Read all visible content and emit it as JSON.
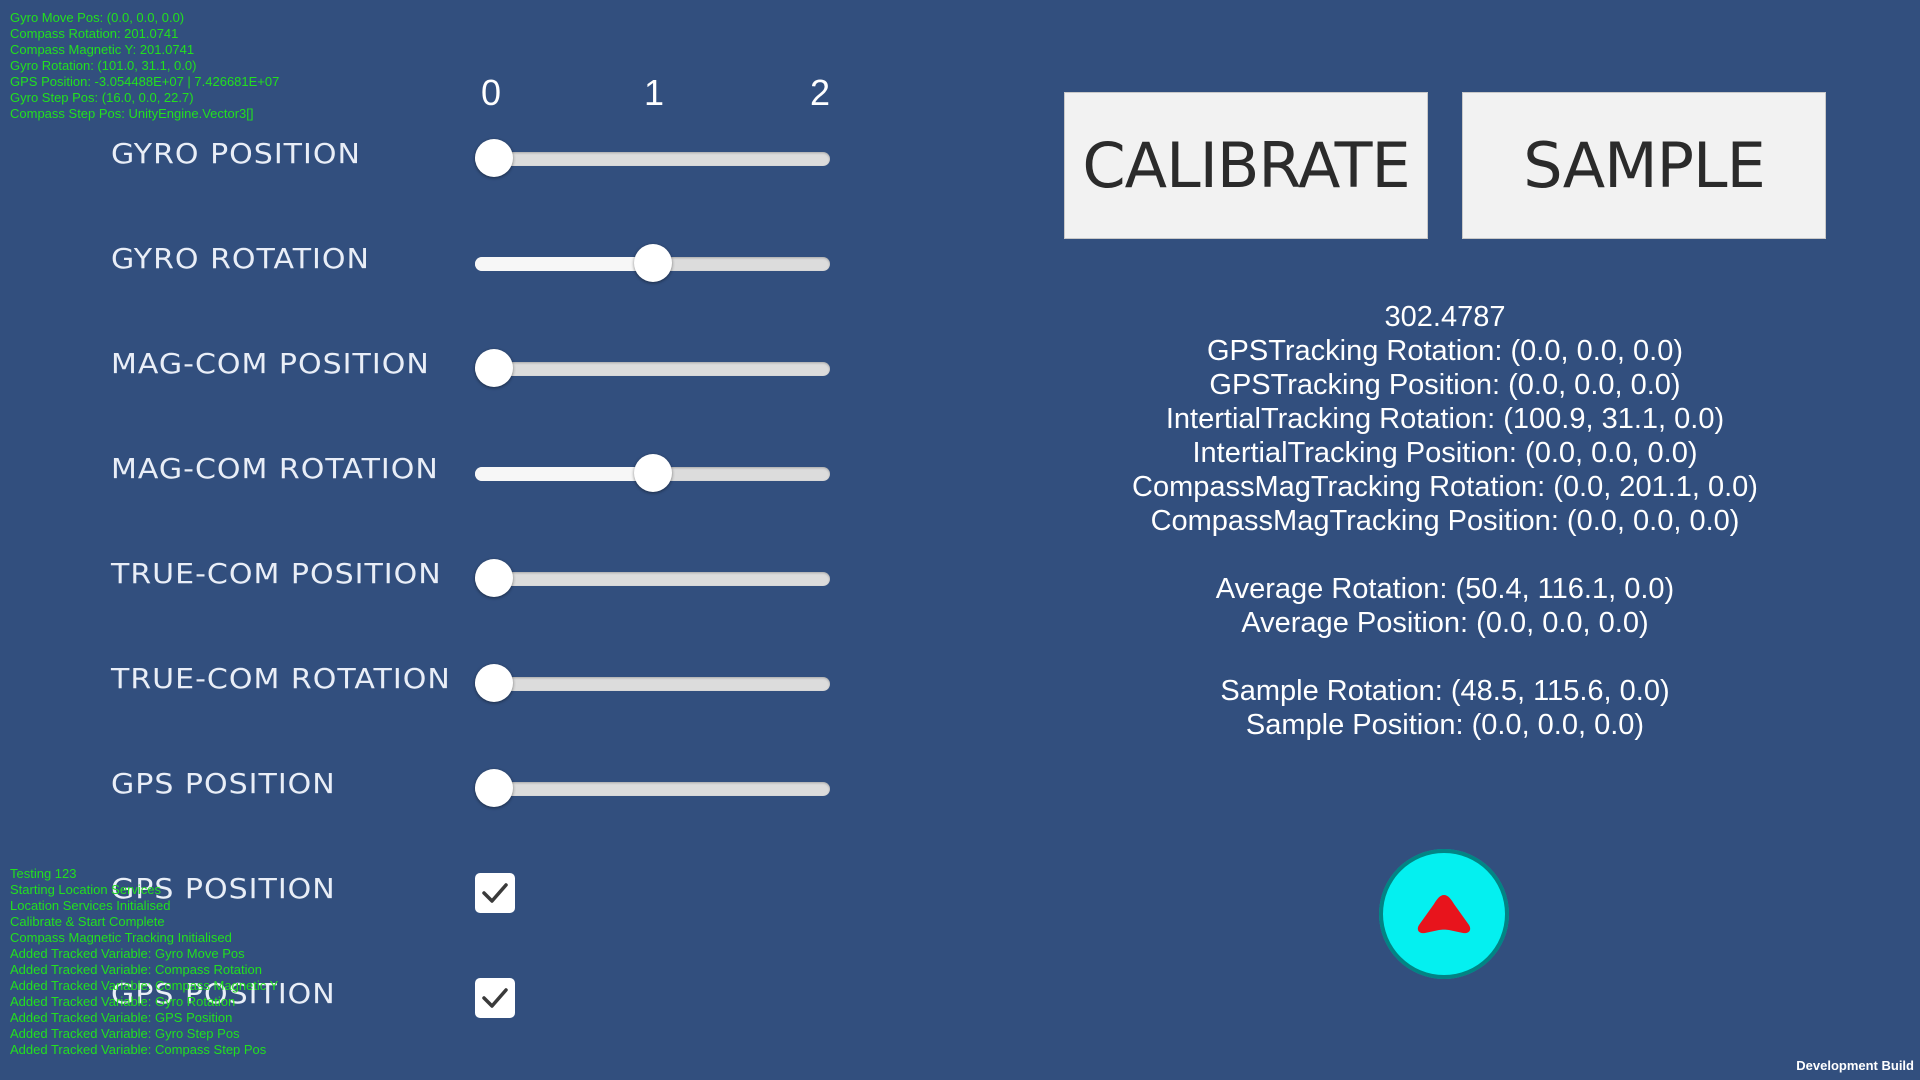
{
  "debug_top": [
    "Gyro Move Pos: (0.0, 0.0, 0.0)",
    "Compass Rotation: 201.0741",
    "Compass Magnetic Y: 201.0741",
    "Gyro Rotation: (101.0, 31.1, 0.0)",
    "GPS Position: -3.054488E+07 | 7.426681E+07",
    "Gyro Step Pos: (16.0, 0.0, 22.7)",
    "Compass Step Pos: UnityEngine.Vector3[]"
  ],
  "debug_bottom": [
    "Testing 123",
    "Starting Location Services",
    "Location Services Initialised",
    "Calibrate & Start Complete",
    "Compass Magnetic Tracking Initialised",
    "Added Tracked Variable: Gyro Move Pos",
    "Added Tracked Variable: Compass Rotation",
    "Added Tracked Variable: Compass Magnetic Y",
    "Added Tracked Variable: Gyro Rotation",
    "Added Tracked Variable: GPS Position",
    "Added Tracked Variable: Gyro Step Pos",
    "Added Tracked Variable: Compass Step Pos"
  ],
  "scale_labels": [
    "0",
    "1",
    "2"
  ],
  "slider_range": [
    0,
    2
  ],
  "trackers": [
    {
      "label": "GYRO POSITION",
      "control": "slider",
      "value": 0
    },
    {
      "label": "GYRO ROTATION",
      "control": "slider",
      "value": 1
    },
    {
      "label": "MAG-COM POSITION",
      "control": "slider",
      "value": 0
    },
    {
      "label": "MAG-COM ROTATION",
      "control": "slider",
      "value": 1
    },
    {
      "label": "TRUE-COM POSITION",
      "control": "slider",
      "value": 0
    },
    {
      "label": "TRUE-COM ROTATION",
      "control": "slider",
      "value": 0
    },
    {
      "label": "GPS POSITION",
      "control": "slider",
      "value": 0
    },
    {
      "label": "GPS POSITION",
      "control": "checkbox",
      "checked": true
    },
    {
      "label": "GPS POSITION",
      "control": "checkbox",
      "checked": true
    }
  ],
  "buttons": {
    "calibrate": "CALIBRATE",
    "sample": "SAMPLE"
  },
  "info": {
    "heading_value": "302.4787",
    "tracking": [
      "GPSTracking Rotation: (0.0, 0.0, 0.0)",
      "GPSTracking Position: (0.0, 0.0, 0.0)",
      "IntertialTracking Rotation: (100.9, 31.1, 0.0)",
      "IntertialTracking Position: (0.0, 0.0, 0.0)",
      "CompassMagTracking Rotation: (0.0, 201.1, 0.0)",
      "CompassMagTracking Position: (0.0, 0.0, 0.0)"
    ],
    "average_rotation": "Average Rotation: (50.4, 116.1, 0.0)",
    "average_position": "Average Position: (0.0, 0.0, 0.0)",
    "sample_rotation": "Sample Rotation: (48.5, 115.6, 0.0)",
    "sample_position": "Sample Position: (0.0, 0.0, 0.0)"
  },
  "arrow_button": {
    "icon": "red-arrow-up-icon",
    "color": "#04f0f0",
    "arrow_color": "#e8141c"
  },
  "footer": {
    "dev_build": "Development Build"
  },
  "colors": {
    "background": "#324f7e",
    "debug_text": "#22e01e"
  }
}
